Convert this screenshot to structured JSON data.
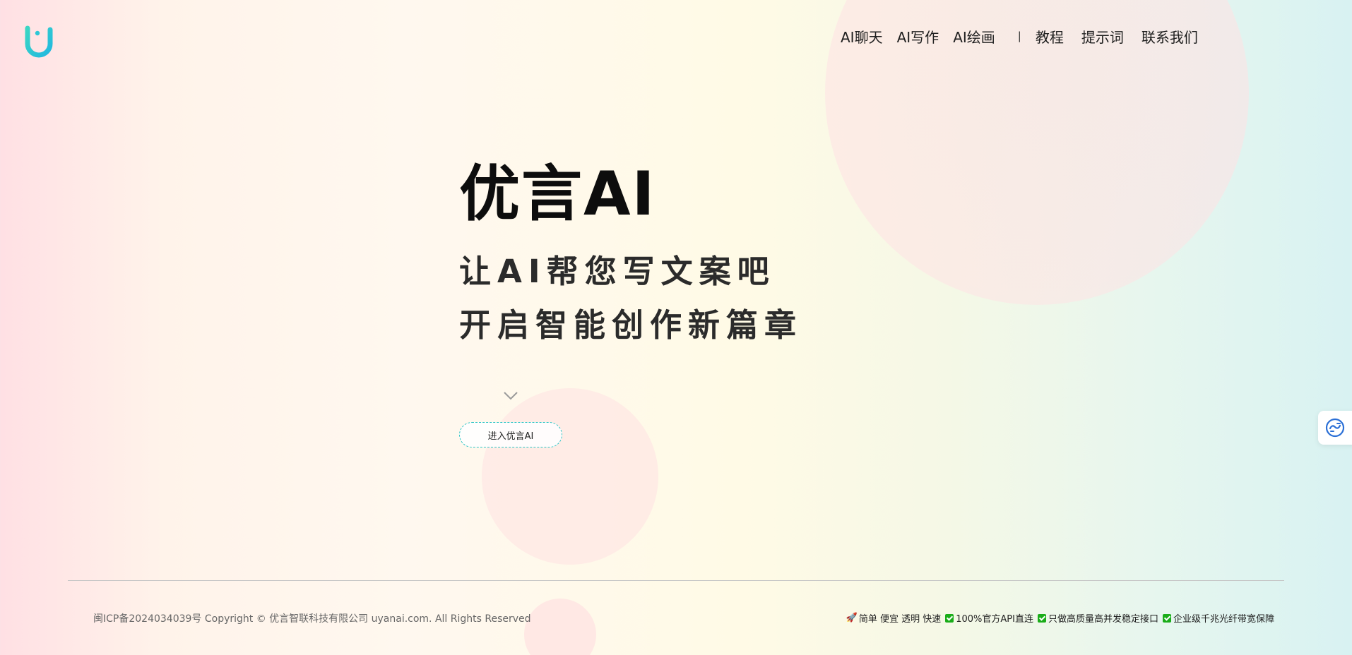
{
  "brand": {
    "accent": "#2ec5c5"
  },
  "nav": {
    "items": [
      "AI聊天",
      "AI写作",
      "AI绘画"
    ],
    "separator": "|",
    "items_right": [
      "教程",
      "提示词",
      "联系我们"
    ]
  },
  "hero": {
    "title": "优言AI",
    "line1": "让AI帮您写文案吧",
    "line2": "开启智能创作新篇章",
    "button_label": "进入优言AI"
  },
  "footer": {
    "copyright": "闽ICP备2024034039号 Copyright © 优言智联科技有限公司 uyanai.com. All Rights Reserved",
    "features": {
      "f1": "简单 便宜 透明 快速",
      "f2": "100%官方API直连",
      "f3": "只做高质量高并发稳定接口",
      "f4": "企业级千兆光纤带宽保障"
    }
  },
  "icons": {
    "logo": "brand-logo-u",
    "chevron": "chevron-down-icon",
    "rocket": "rocket-icon",
    "check": "check-icon",
    "side": "translate-icon"
  }
}
